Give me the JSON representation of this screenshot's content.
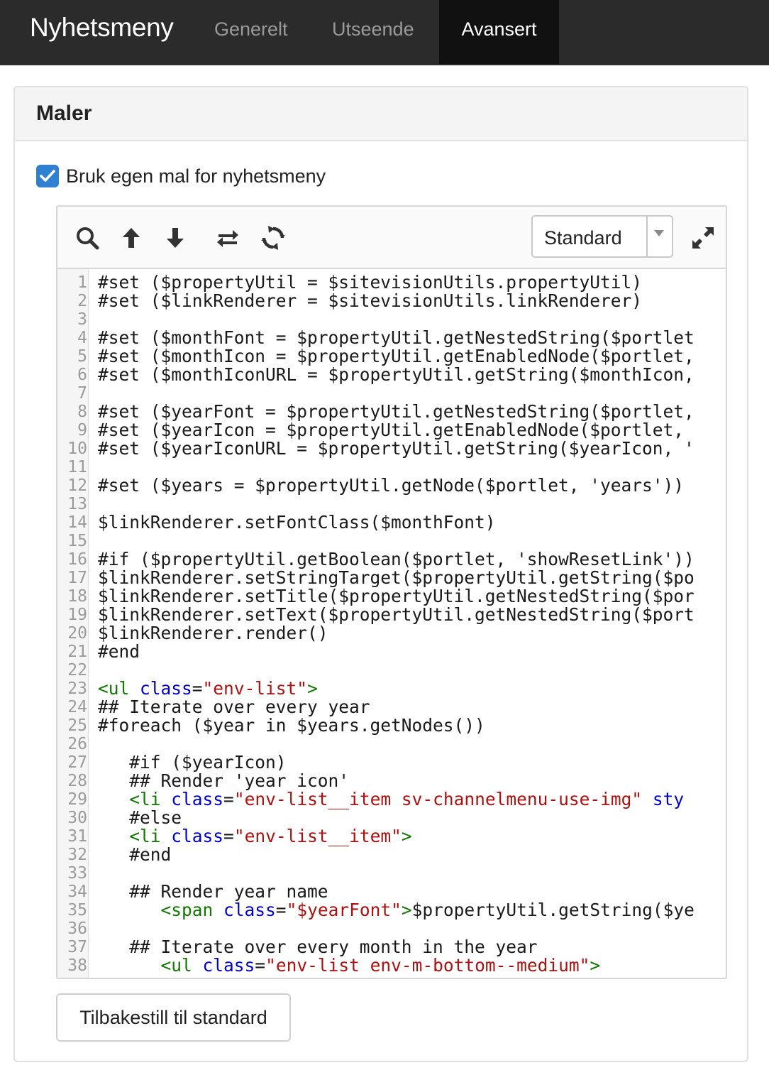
{
  "nav": {
    "brand": "Nyhetsmeny",
    "tabs": [
      {
        "label": "Generelt",
        "active": false
      },
      {
        "label": "Utseende",
        "active": false
      },
      {
        "label": "Avansert",
        "active": true
      }
    ]
  },
  "panel": {
    "title": "Maler",
    "checkbox": {
      "label": "Bruk egen mal for nyhetsmeny",
      "checked": true
    },
    "reset_button": "Tilbakestill til standard"
  },
  "editor": {
    "toolbar": {
      "icons": [
        "search-icon",
        "arrow-up-icon",
        "arrow-down-icon",
        "swap-icon",
        "refresh-icon",
        "expand-icon"
      ],
      "theme_select": "Standard"
    },
    "code_lines": [
      {
        "n": "1",
        "segs": [
          {
            "t": "#set ($propertyUtil = $sitevisionUtils.propertyUtil)",
            "c": ""
          }
        ]
      },
      {
        "n": "2",
        "segs": [
          {
            "t": "#set ($linkRenderer = $sitevisionUtils.linkRenderer)",
            "c": ""
          }
        ]
      },
      {
        "n": "3",
        "segs": []
      },
      {
        "n": "4",
        "segs": [
          {
            "t": "#set ($monthFont = $propertyUtil.getNestedString($portlet",
            "c": ""
          }
        ]
      },
      {
        "n": "5",
        "segs": [
          {
            "t": "#set ($monthIcon = $propertyUtil.getEnabledNode($portlet,",
            "c": ""
          }
        ]
      },
      {
        "n": "6",
        "segs": [
          {
            "t": "#set ($monthIconURL = $propertyUtil.getString($monthIcon,",
            "c": ""
          }
        ]
      },
      {
        "n": "7",
        "segs": []
      },
      {
        "n": "8",
        "segs": [
          {
            "t": "#set ($yearFont = $propertyUtil.getNestedString($portlet,",
            "c": ""
          }
        ]
      },
      {
        "n": "9",
        "segs": [
          {
            "t": "#set ($yearIcon = $propertyUtil.getEnabledNode($portlet, ",
            "c": ""
          }
        ]
      },
      {
        "n": "10",
        "segs": [
          {
            "t": "#set ($yearIconURL = $propertyUtil.getString($yearIcon, '",
            "c": ""
          }
        ]
      },
      {
        "n": "11",
        "segs": []
      },
      {
        "n": "12",
        "segs": [
          {
            "t": "#set ($years = $propertyUtil.getNode($portlet, 'years'))",
            "c": ""
          }
        ]
      },
      {
        "n": "13",
        "segs": []
      },
      {
        "n": "14",
        "segs": [
          {
            "t": "$linkRenderer.setFontClass($monthFont)",
            "c": ""
          }
        ]
      },
      {
        "n": "15",
        "segs": []
      },
      {
        "n": "16",
        "segs": [
          {
            "t": "#if ($propertyUtil.getBoolean($portlet, 'showResetLink'))",
            "c": ""
          }
        ]
      },
      {
        "n": "17",
        "segs": [
          {
            "t": "$linkRenderer.setStringTarget($propertyUtil.getString($po",
            "c": ""
          }
        ]
      },
      {
        "n": "18",
        "segs": [
          {
            "t": "$linkRenderer.setTitle($propertyUtil.getNestedString($por",
            "c": ""
          }
        ]
      },
      {
        "n": "19",
        "segs": [
          {
            "t": "$linkRenderer.setText($propertyUtil.getNestedString($port",
            "c": ""
          }
        ]
      },
      {
        "n": "20",
        "segs": [
          {
            "t": "$linkRenderer.render()",
            "c": ""
          }
        ]
      },
      {
        "n": "21",
        "segs": [
          {
            "t": "#end",
            "c": ""
          }
        ]
      },
      {
        "n": "22",
        "segs": []
      },
      {
        "n": "23",
        "segs": [
          {
            "t": "<ul ",
            "c": "tag"
          },
          {
            "t": "class",
            "c": "attr"
          },
          {
            "t": "=",
            "c": ""
          },
          {
            "t": "\"env-list\"",
            "c": "str"
          },
          {
            "t": ">",
            "c": "tag"
          }
        ]
      },
      {
        "n": "24",
        "segs": [
          {
            "t": "## Iterate over every year",
            "c": ""
          }
        ]
      },
      {
        "n": "25",
        "segs": [
          {
            "t": "#foreach ($year in $years.getNodes())",
            "c": ""
          }
        ]
      },
      {
        "n": "26",
        "segs": []
      },
      {
        "n": "27",
        "segs": [
          {
            "t": "   #if ($yearIcon)",
            "c": ""
          }
        ]
      },
      {
        "n": "28",
        "segs": [
          {
            "t": "   ## Render 'year icon'",
            "c": ""
          }
        ]
      },
      {
        "n": "29",
        "segs": [
          {
            "t": "   ",
            "c": ""
          },
          {
            "t": "<li ",
            "c": "tag"
          },
          {
            "t": "class",
            "c": "attr"
          },
          {
            "t": "=",
            "c": ""
          },
          {
            "t": "\"env-list__item sv-channelmenu-use-img\"",
            "c": "str"
          },
          {
            "t": " sty",
            "c": "attr"
          }
        ]
      },
      {
        "n": "30",
        "segs": [
          {
            "t": "   #else",
            "c": ""
          }
        ]
      },
      {
        "n": "31",
        "segs": [
          {
            "t": "   ",
            "c": ""
          },
          {
            "t": "<li ",
            "c": "tag"
          },
          {
            "t": "class",
            "c": "attr"
          },
          {
            "t": "=",
            "c": ""
          },
          {
            "t": "\"env-list__item\"",
            "c": "str"
          },
          {
            "t": ">",
            "c": "tag"
          }
        ]
      },
      {
        "n": "32",
        "segs": [
          {
            "t": "   #end",
            "c": ""
          }
        ]
      },
      {
        "n": "33",
        "segs": []
      },
      {
        "n": "34",
        "segs": [
          {
            "t": "   ## Render year name",
            "c": ""
          }
        ]
      },
      {
        "n": "35",
        "segs": [
          {
            "t": "      ",
            "c": ""
          },
          {
            "t": "<span ",
            "c": "tag"
          },
          {
            "t": "class",
            "c": "attr"
          },
          {
            "t": "=",
            "c": ""
          },
          {
            "t": "\"$yearFont\"",
            "c": "str"
          },
          {
            "t": ">",
            "c": "tag"
          },
          {
            "t": "$propertyUtil.getString($ye",
            "c": ""
          }
        ]
      },
      {
        "n": "36",
        "segs": []
      },
      {
        "n": "37",
        "segs": [
          {
            "t": "   ## Iterate over every month in the year",
            "c": ""
          }
        ]
      },
      {
        "n": "38",
        "segs": [
          {
            "t": "      ",
            "c": ""
          },
          {
            "t": "<ul ",
            "c": "tag"
          },
          {
            "t": "class",
            "c": "attr"
          },
          {
            "t": "=",
            "c": ""
          },
          {
            "t": "\"env-list env-m-bottom--medium\"",
            "c": "str"
          },
          {
            "t": ">",
            "c": "tag"
          }
        ]
      }
    ]
  }
}
